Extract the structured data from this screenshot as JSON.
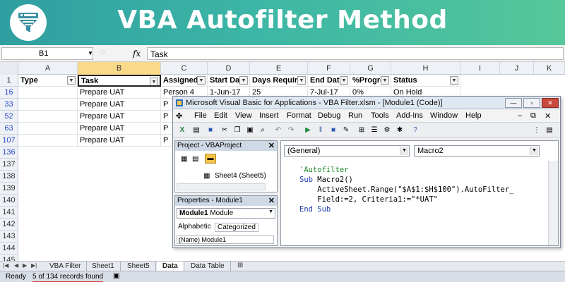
{
  "banner": {
    "title": "VBA Autofilter Method",
    "logo_icon": "funnel-spreadsheet-icon"
  },
  "formula_bar": {
    "name_box": "B1",
    "fx_label": "fx",
    "formula": "Task"
  },
  "columns": [
    "A",
    "B",
    "C",
    "D",
    "E",
    "F",
    "G",
    "H",
    "I",
    "J",
    "K"
  ],
  "header_row_number": "1",
  "headers": [
    "Type",
    "Task",
    "Assigned T",
    "Start Dat",
    "Days Require",
    "End Date",
    "%Progre",
    "Status"
  ],
  "rows": [
    {
      "num": "16",
      "cells": [
        "",
        "Prepare UAT",
        "Person 4",
        "1-Jun-17",
        "25",
        "7-Jul-17",
        "0%",
        "On Hold"
      ]
    },
    {
      "num": "33",
      "cells": [
        "",
        "Prepare UAT",
        "P",
        "",
        "",
        "",
        "",
        ""
      ]
    },
    {
      "num": "52",
      "cells": [
        "",
        "Prepare UAT",
        "P",
        "",
        "",
        "",
        "",
        ""
      ]
    },
    {
      "num": "63",
      "cells": [
        "",
        "Prepare UAT",
        "P",
        "",
        "",
        "",
        "",
        ""
      ]
    },
    {
      "num": "107",
      "cells": [
        "",
        "Prepare UAT",
        "P",
        "",
        "",
        "",
        "",
        ""
      ]
    },
    {
      "num": "136",
      "cells": []
    },
    {
      "num": "137",
      "cells": []
    },
    {
      "num": "138",
      "cells": []
    },
    {
      "num": "139",
      "cells": []
    },
    {
      "num": "140",
      "cells": []
    },
    {
      "num": "141",
      "cells": []
    },
    {
      "num": "142",
      "cells": []
    },
    {
      "num": "143",
      "cells": []
    },
    {
      "num": "144",
      "cells": []
    },
    {
      "num": "145",
      "cells": []
    }
  ],
  "sheet_tabs": [
    "VBA Filter",
    "Sheet1",
    "Sheet5",
    "Data",
    "Data Table"
  ],
  "active_tab": "Data",
  "status": {
    "ready": "Ready",
    "records": "5 of 134 records found"
  },
  "vbe": {
    "title": "Microsoft Visual Basic for Applications - VBA Filter.xlsm - [Module1 (Code)]",
    "menu": [
      "File",
      "Edit",
      "View",
      "Insert",
      "Format",
      "Debug",
      "Run",
      "Tools",
      "Add-Ins",
      "Window",
      "Help"
    ],
    "project_pane_title": "Project - VBAProject",
    "project_item": "Sheet4 (Sheet5)",
    "properties_pane_title": "Properties - Module1",
    "properties_select": "Module1",
    "properties_select_type": "Module",
    "props_tabs": [
      "Alphabetic",
      "Categorized"
    ],
    "props_row": "(Name) Module1",
    "object_combo": "(General)",
    "proc_combo": "Macro2",
    "code_lines": {
      "comment": "'Autofilter",
      "sub_kw": "Sub",
      "sub_name": " Macro2()",
      "line3": "    ActiveSheet.Range(\"$A$1:$H$100\").AutoFilter_",
      "line4": "    Field:=2, Criteria1:=\"*UAT\"",
      "end_kw": "End Sub"
    }
  }
}
